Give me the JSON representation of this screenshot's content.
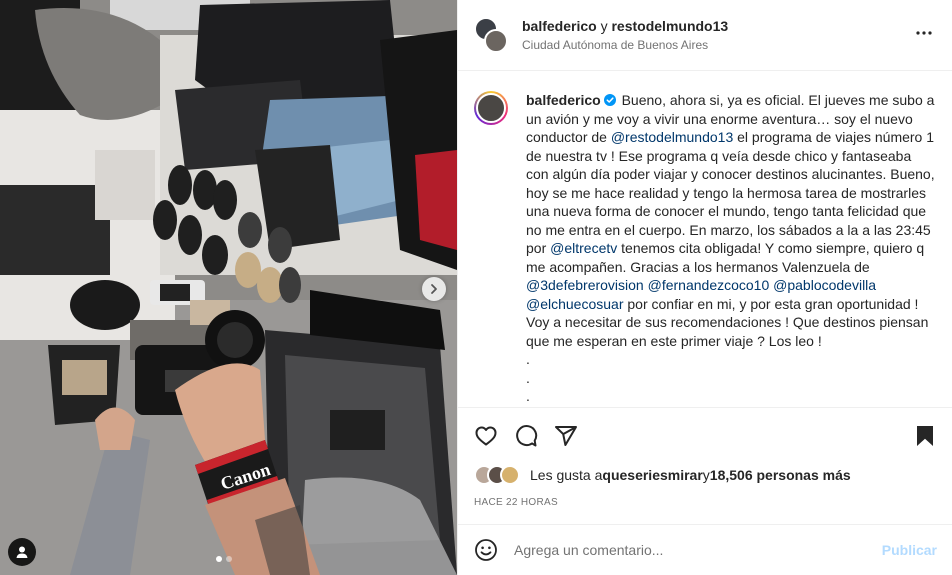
{
  "post": {
    "photo": {
      "alt_icons": {
        "next": "chevron-right-icon",
        "tag": "user-tag-icon"
      },
      "carousel": {
        "count": 2,
        "active_index": 0
      }
    },
    "header": {
      "user1": "balfederico",
      "connector": "y",
      "user2": "restodelmundo13",
      "location": "Ciudad Autónoma de Buenos Aires",
      "more_icon": "more-horizontal-icon"
    },
    "caption": {
      "username": "balfederico",
      "seg1": " Bueno, ahora si, ya es oficial. El jueves me subo a un avión y me voy a vivir una enorme aventura… soy el nuevo conductor de ",
      "mention1": "@restodelmundo13",
      "seg2": " el programa de viajes número 1 de nuestra tv ! Ese programa q veía desde chico y fantaseaba con algún día poder viajar y conocer destinos alucinantes. Bueno, hoy se me hace realidad y tengo la hermosa tarea de mostrarles una nueva forma de conocer el mundo, tengo tanta felicidad que no me entra en el cuerpo. En marzo, los sábados a la a las 23:45 por ",
      "mention2": "@eltrecetv",
      "seg3": " tenemos cita obligada! Y como siempre, quiero q me acompañen. Gracias a los hermanos Valenzuela de ",
      "mention3": "@3defebrerovision",
      "mention4": "@fernandezcoco10",
      "mention5": "@pablocodevilla",
      "mention6": "@elchuecosuar",
      "seg4": " por confiar en mi, y por esta gran oportunidad ! Voy a necesitar de sus recomendaciones ! Que destinos piensan que me esperan en este primer viaje ? Los leo !",
      "dot": "."
    },
    "actions": {
      "icons": [
        "heart-icon",
        "comment-icon",
        "share-icon",
        "bookmark-icon"
      ]
    },
    "likes": {
      "prefix": "Les gusta a ",
      "first_user": "queseriesmirar",
      "middle": " y ",
      "count": "18,506 personas más"
    },
    "timestamp": "HACE 22 HORAS",
    "comment_box": {
      "placeholder": "Agrega un comentario...",
      "publish_label": "Publicar"
    }
  },
  "colors": {
    "mention": "#00376b",
    "secondary_text": "#737373",
    "publish_disabled": "#b3dbff",
    "verified": "#0095f6"
  }
}
